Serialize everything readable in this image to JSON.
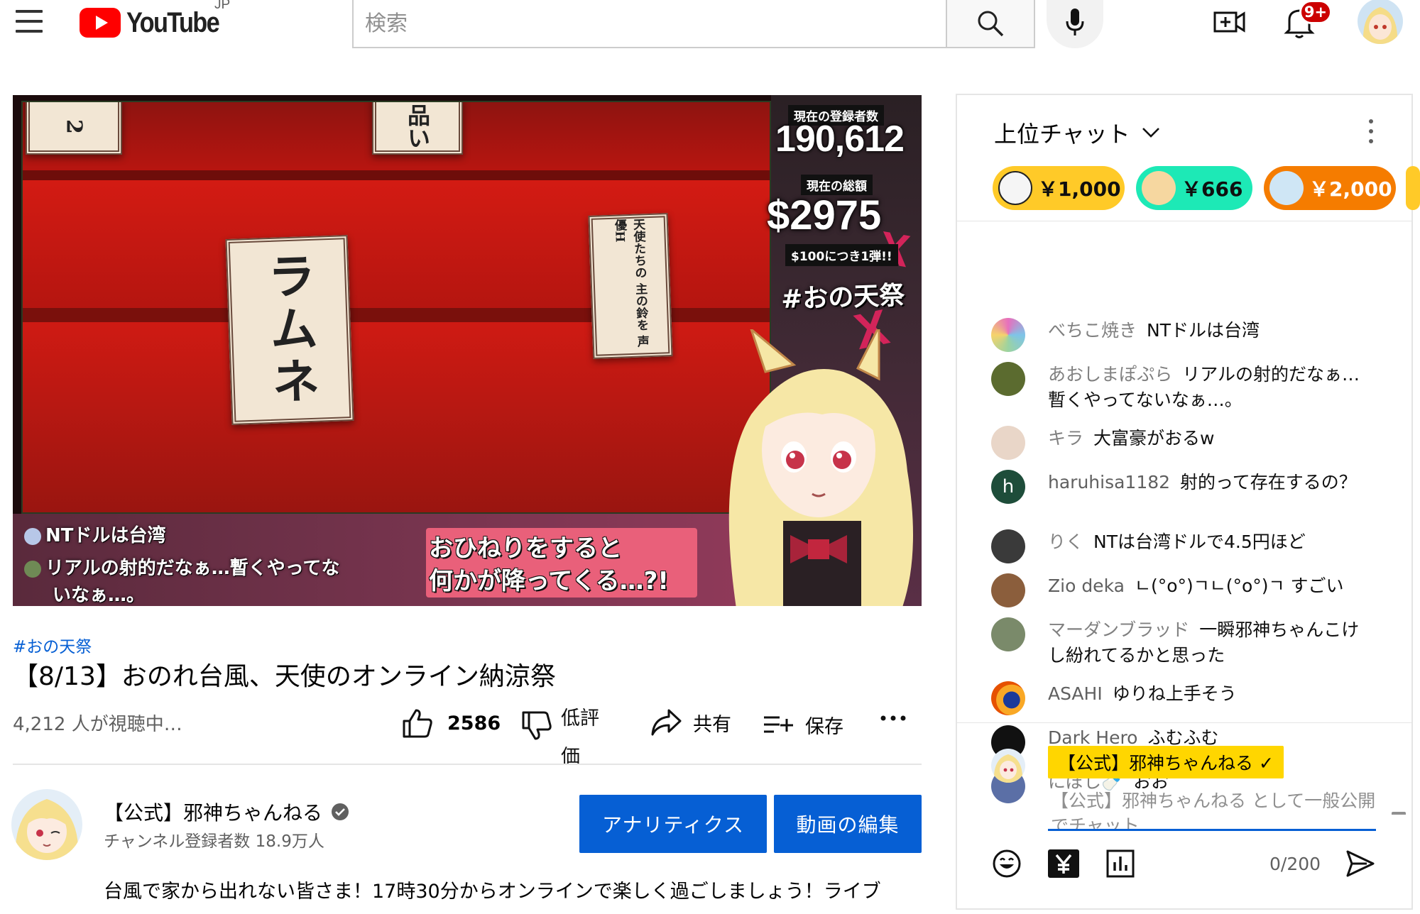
{
  "header": {
    "logo_text": "YouTube",
    "region": "JP",
    "search_placeholder": "検索",
    "notification_count": "9+"
  },
  "video": {
    "overlay": {
      "subscriber_label": "現在の登録者数",
      "subscriber_count": "190,612",
      "total_label": "現在の総額",
      "total_amount": "$2975",
      "per_label": "$100につき1弾!!",
      "hashtag": "#おの天祭",
      "card_center": "ラムネ",
      "card_right": "天使たちの 主の鈴を 声優H",
      "card_top": "品い",
      "card_topleft": "2",
      "chat_lines": [
        "NTドルは台湾",
        "リアルの射的だなぁ…暫くやってな",
        "いなぁ…。"
      ],
      "caption_line1": "おひねりをすると",
      "caption_line2": "何かが降ってくる…?!"
    },
    "hashtag": "#おの天祭",
    "title": "【8/13】おのれ台風、天使のオンライン納涼祭",
    "viewers": "4,212 人が視聴中…",
    "like_count": "2586",
    "dislike_label": "低評価",
    "share_label": "共有",
    "save_label": "保存"
  },
  "channel": {
    "name": "【公式】邪神ちゃんねる",
    "subscribers": "チャンネル登録者数 18.9万人",
    "analytics_button": "アナリティクス",
    "edit_button": "動画の編集",
    "description": "台風で家から出れない皆さま！17時30分からオンラインで楽しく過ごしましょう！ライブ"
  },
  "chat": {
    "title": "上位チャット",
    "tickers": [
      {
        "amount": "￥1,000",
        "color": "#ffca28",
        "av": "#f3f3f3"
      },
      {
        "amount": "￥666",
        "color": "#1de9b6",
        "av": "#f6d7a0"
      },
      {
        "amount": "￥2,000",
        "color": "#f57c00",
        "av": "#cfe6f5"
      }
    ],
    "messages": [
      {
        "author": "べちこ焼き",
        "text": "NTドルは台湾",
        "av": "#9bd3a1",
        "bold": false
      },
      {
        "author": "あおしまぽぷら",
        "text": "リアルの射的だなぁ…暫くやってないなぁ…。",
        "av": "#5b6b2f",
        "bold": false
      },
      {
        "author": "キラ",
        "text": "大富豪がおるw",
        "av": "#e9d6c8",
        "bold": false
      },
      {
        "author": "haruhisa1182",
        "text": "射的って存在するの？",
        "av": "#1e4d3a",
        "bold": true,
        "initial": "h"
      },
      {
        "author": "りく",
        "text": "NTは台湾ドルで4.5円ほど",
        "av": "#3a3a3a",
        "bold": false
      },
      {
        "author": "Zio deka",
        "text": "ㄴ(°o°)ㄱㄴ(°o°)ㄱ すごい",
        "av": "#8b5e3c",
        "bold": true
      },
      {
        "author": "マーダンブラッド",
        "text": "一瞬邪神ちゃんこけし紛れてるかと思った",
        "av": "#7a8a6a",
        "bold": false
      },
      {
        "author": "ASAHI",
        "text": "ゆりね上手そう",
        "av": "#e65100",
        "bold": true
      },
      {
        "author": "Dark Hero",
        "text": "ふむふむ",
        "av": "#111111",
        "bold": true
      },
      {
        "author": "にぼし🍼",
        "text": "おお",
        "av": "#5b6fa6",
        "bold": false
      }
    ],
    "owner_tag": "【公式】邪神ちゃんねる ✓",
    "input_placeholder": "【公式】邪神ちゃんねる として一般公開でチャット...",
    "counter": "0/200"
  }
}
